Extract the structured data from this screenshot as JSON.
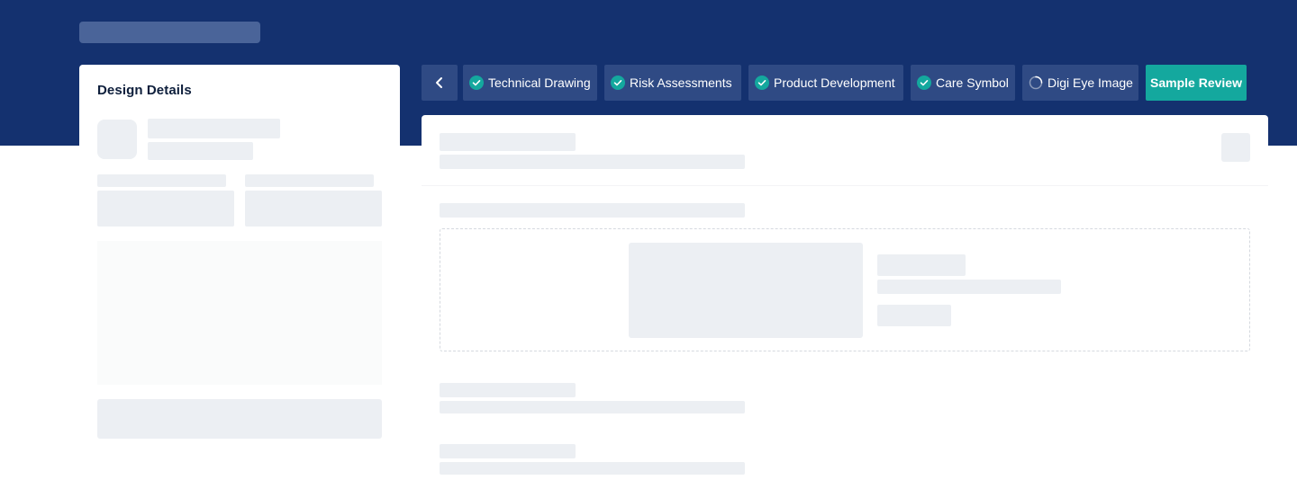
{
  "left_panel": {
    "title": "Design Details"
  },
  "tabs": [
    {
      "label": "Technical Drawing",
      "status": "complete",
      "icon": "check-circle-icon"
    },
    {
      "label": "Risk Assessments",
      "status": "complete",
      "icon": "check-circle-icon"
    },
    {
      "label": "Product Development",
      "status": "complete",
      "icon": "check-circle-icon"
    },
    {
      "label": "Care Symbol",
      "status": "complete",
      "icon": "check-circle-icon"
    },
    {
      "label": "Digi Eye Image",
      "status": "loading",
      "icon": "spinner-icon"
    },
    {
      "label": "Sample Review",
      "status": "active"
    }
  ],
  "colors": {
    "header": "#14316f",
    "tab": "#2f4a84",
    "accent": "#14a89e",
    "skeleton": "#eceff3"
  }
}
